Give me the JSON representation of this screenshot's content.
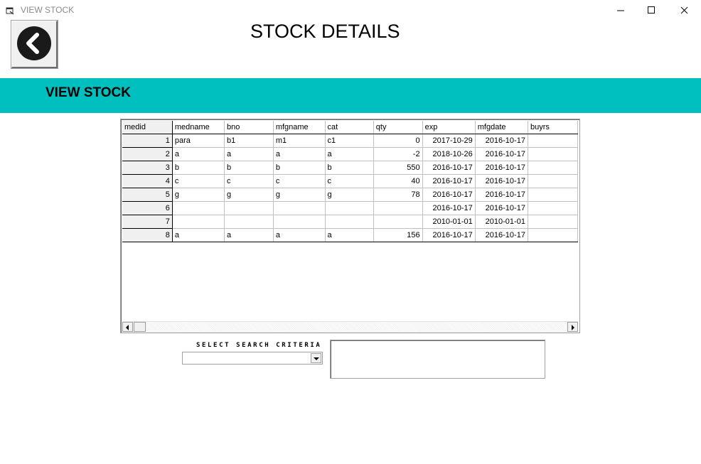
{
  "window": {
    "title": "VIEW STOCK",
    "app_icon": "window-icon"
  },
  "header": {
    "title": "STOCK DETAILS",
    "back_icon": "back-arrow-icon"
  },
  "band": {
    "title": "VIEW STOCK",
    "color": "#00bfbf"
  },
  "grid": {
    "columns": [
      "medid",
      "medname",
      "bno",
      "mfgname",
      "cat",
      "qty",
      "exp",
      "mfgdate",
      "buyrs"
    ],
    "rows": [
      [
        "1",
        "para",
        "b1",
        "m1",
        "c1",
        "0",
        "2017-10-29",
        "2016-10-17",
        ""
      ],
      [
        "2",
        "a",
        "a",
        "a",
        "a",
        "-2",
        "2018-10-26",
        "2016-10-17",
        ""
      ],
      [
        "3",
        "b",
        "b",
        "b",
        "b",
        "550",
        "2016-10-17",
        "2016-10-17",
        ""
      ],
      [
        "4",
        "c",
        "c",
        "c",
        "c",
        "40",
        "2016-10-17",
        "2016-10-17",
        ""
      ],
      [
        "5",
        "g",
        "g",
        "g",
        "g",
        "78",
        "2016-10-17",
        "2016-10-17",
        ""
      ],
      [
        "6",
        "",
        "",
        "",
        "",
        "",
        "2016-10-17",
        "2016-10-17",
        ""
      ],
      [
        "7",
        "",
        "",
        "",
        "",
        "",
        "2010-01-01",
        "2010-01-01",
        ""
      ],
      [
        "8",
        "a",
        "a",
        "a",
        "a",
        "156",
        "2016-10-17",
        "2016-10-17",
        ""
      ]
    ]
  },
  "search": {
    "criteria_label": "SELECT SEARCH CRITERIA",
    "criteria_value": "",
    "text_value": ""
  }
}
